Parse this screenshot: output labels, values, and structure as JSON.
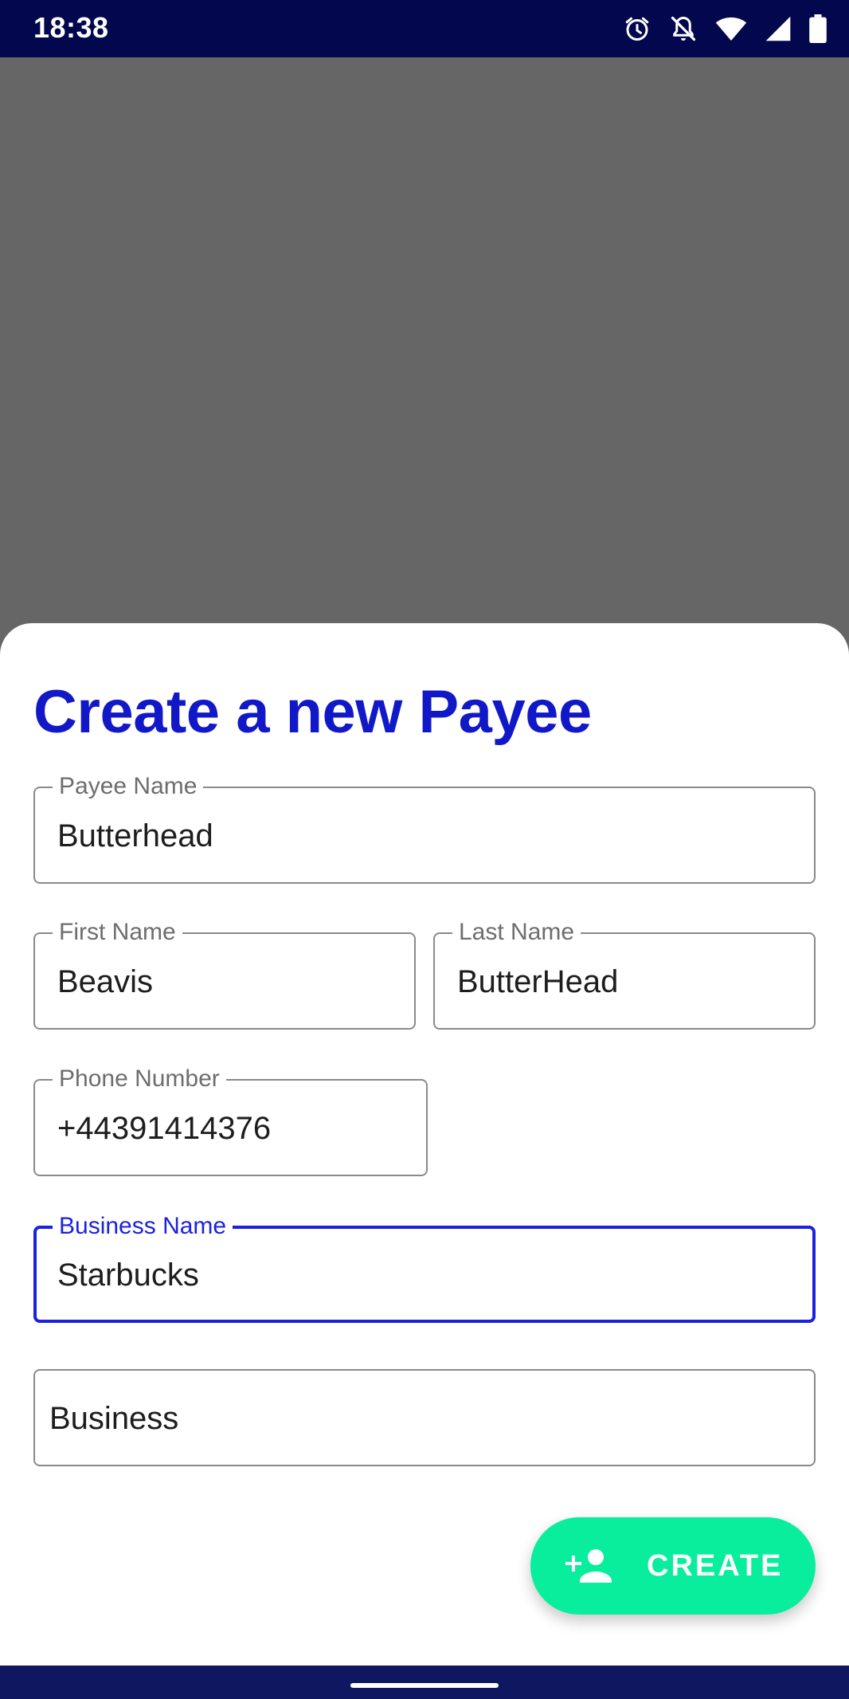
{
  "status_bar": {
    "time": "18:38",
    "icons": [
      "alarm-icon",
      "notifications-off-icon",
      "wifi-icon",
      "cellular-signal-icon",
      "battery-icon"
    ]
  },
  "sheet": {
    "title": "Create a new Payee",
    "fields": {
      "payee_name": {
        "label": "Payee Name",
        "value": "Butterhead"
      },
      "first_name": {
        "label": "First Name",
        "value": "Beavis"
      },
      "last_name": {
        "label": "Last Name",
        "value": "ButterHead"
      },
      "phone_number": {
        "label": "Phone Number",
        "value": "+44391414376"
      },
      "business_name": {
        "label": "Business Name",
        "value": "Starbucks",
        "focused": true
      },
      "payee_type": {
        "value": "Business"
      }
    },
    "create_button": {
      "label": "CREATE",
      "icon": "person-add-icon"
    }
  },
  "colors": {
    "status_bar": "#03074d",
    "scrim": "#666666",
    "accent_title": "#1118c8",
    "focus_border": "#1a22e0",
    "create_button": "#08ee9d",
    "nav_bar": "#0f1760"
  }
}
